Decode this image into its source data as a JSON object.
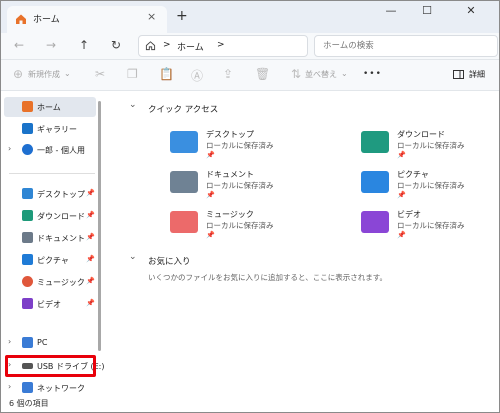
{
  "window": {
    "tab_title": "ホーム",
    "tab_close": "×",
    "new_tab": "+",
    "minimize": "—",
    "maximize": "☐",
    "close": "✕"
  },
  "address": {
    "back": "←",
    "forward": "→",
    "up": "↑",
    "refresh": "↻",
    "path": [
      "ホーム"
    ],
    "sep": ">",
    "search_placeholder": "ホームの検索"
  },
  "toolbar": {
    "new_label": "新規作成",
    "new_arrow": "⌄",
    "sort_label": "並べ替え",
    "sort_arrow": "⌄",
    "more": "•••",
    "details_label": "詳細"
  },
  "sidebar": {
    "items": [
      {
        "label": "ホーム",
        "icon": "home-icon",
        "color": "#e8722a",
        "active": true
      },
      {
        "label": "ギャラリー",
        "icon": "gallery-icon",
        "color": "#1a73c9"
      },
      {
        "label": "一郎 - 個人用",
        "icon": "onedrive-icon",
        "color": "#1e6fd0",
        "chevron": true
      }
    ],
    "pinned": [
      {
        "label": "デスクトップ",
        "icon": "desktop-icon",
        "color": "#2f86d4"
      },
      {
        "label": "ダウンロード",
        "icon": "download-icon",
        "color": "#1e9a7a"
      },
      {
        "label": "ドキュメント",
        "icon": "documents-icon",
        "color": "#6c7a89"
      },
      {
        "label": "ピクチャ",
        "icon": "pictures-icon",
        "color": "#1f7bd6"
      },
      {
        "label": "ミュージック",
        "icon": "music-icon",
        "color": "#e0573b"
      },
      {
        "label": "ビデオ",
        "icon": "video-icon",
        "color": "#7d3fc8"
      }
    ],
    "pin_glyph": "📌",
    "drives": [
      {
        "label": "PC",
        "icon": "pc-icon",
        "color": "#3a7bd5"
      },
      {
        "label": "USB ドライブ (E:)",
        "icon": "usb-drive-icon",
        "color": "#555555"
      },
      {
        "label": "ネットワーク",
        "icon": "network-icon",
        "color": "#3a7bd5"
      }
    ],
    "chevron": "›"
  },
  "quick_access": {
    "header": "クイック アクセス",
    "chevron": "⌄",
    "tiles": [
      {
        "name": "デスクトップ",
        "sub": "ローカルに保存済み",
        "icon": "desktop-folder-icon",
        "color": "#3a8fe0"
      },
      {
        "name": "ダウンロード",
        "sub": "ローカルに保存済み",
        "icon": "download-folder-icon",
        "color": "#1f9a80"
      },
      {
        "name": "ドキュメント",
        "sub": "ローカルに保存済み",
        "icon": "documents-folder-icon",
        "color": "#6f8294"
      },
      {
        "name": "ピクチャ",
        "sub": "ローカルに保存済み",
        "icon": "pictures-folder-icon",
        "color": "#2a86e0"
      },
      {
        "name": "ミュージック",
        "sub": "ローカルに保存済み",
        "icon": "music-folder-icon",
        "color": "#ec6a6a"
      },
      {
        "name": "ビデオ",
        "sub": "ローカルに保存済み",
        "icon": "video-folder-icon",
        "color": "#8a46d6"
      }
    ],
    "pin_glyph": "📌"
  },
  "favorites": {
    "header": "お気に入り",
    "chevron": "⌄",
    "empty_text": "いくつかのファイルをお気に入りに追加すると、ここに表示されます。"
  },
  "status": {
    "text": "6 個の項目"
  },
  "colors": {
    "highlight": "#e8000a"
  }
}
